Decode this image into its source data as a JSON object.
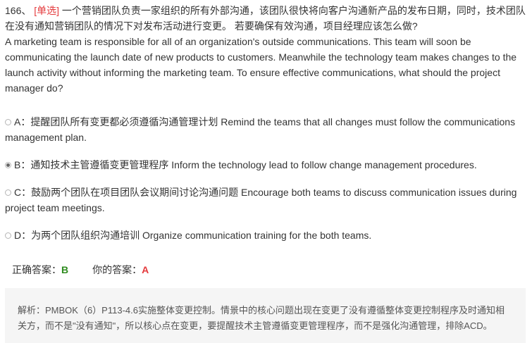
{
  "question": {
    "number": "166、",
    "type_tag": "[单选]",
    "text_cn": "一个营销团队负责一家组织的所有外部沟通，该团队很快将向客户沟通新产品的发布日期，同时，技术团队在没有通知营销团队的情况下对发布活动进行变更。 若要确保有效沟通，项目经理应该怎么做?",
    "text_en": "A marketing team is responsible for all of an organization's outside communications. This team will soon be communicating the launch date of new products to customers. Meanwhile the technology team makes changes to the launch activity without informing the marketing team. To ensure effective communications, what should the project manager do?"
  },
  "options": [
    {
      "label": "A：提醒团队所有变更都必须遵循沟通管理计划 Remind the teams that all changes must follow the communications management plan.",
      "selected": false
    },
    {
      "label": "B：通知技术主管遵循变更管理程序 Inform the technology lead to follow change management procedures.",
      "selected": true
    },
    {
      "label": "C：鼓励两个团队在项目团队会议期间讨论沟通问题 Encourage both teams to discuss communication issues during project team meetings.",
      "selected": false
    },
    {
      "label": "D：为两个团队组织沟通培训 Organize communication training for the both teams.",
      "selected": false
    }
  ],
  "answers": {
    "correct_label": "正确答案：",
    "correct_value": "B",
    "yours_label": "你的答案：",
    "yours_value": "A"
  },
  "analysis": {
    "text": "解析：PMBOK（6）P113-4.6实施整体变更控制。情景中的核心问题出现在变更了没有遵循整体变更控制程序及时通知相关方，而不是\"没有通知\"，所以核心点在变更，要提醒技术主管遵循变更管理程序，而不是强化沟通管理，排除ACD。"
  },
  "colors": {
    "tag": "#e4393c",
    "correct": "#2e8b1e",
    "wrong": "#e4393c",
    "analysis_bg": "#f5f5f5"
  }
}
